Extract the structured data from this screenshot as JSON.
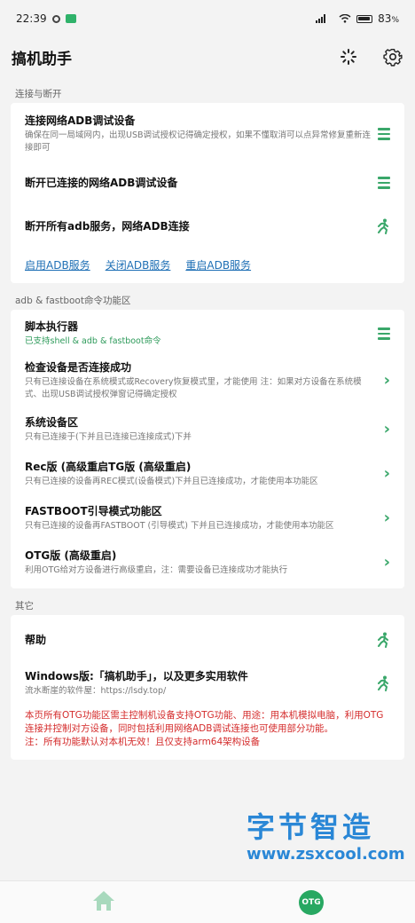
{
  "status_bar": {
    "time": "22:39",
    "battery": "83",
    "battery_suffix": "%",
    "battery_level": 0.83
  },
  "app": {
    "title": "搞机助手"
  },
  "icons": {
    "refresh": "loading-icon",
    "settings": "gear-icon",
    "home": "home-icon"
  },
  "sections": {
    "connect": {
      "label": "连接与断开",
      "rows": [
        {
          "title": "连接网络ADB调试设备",
          "desc": "确保在同一局域网内，出现USB调试授权记得确定授权，如果不懂取消可以点异常修复重新连接即可",
          "icon": "menu-icon"
        },
        {
          "title": "断开已连接的网络ADB调试设备",
          "icon": "menu-icon"
        },
        {
          "title": "断开所有adb服务，网络ADB连接",
          "icon": "running-person-icon"
        }
      ],
      "links": [
        "启用ADB服务",
        "关闭ADB服务",
        "重启ADB服务"
      ]
    },
    "fastboot": {
      "label": "adb & fastboot命令功能区",
      "rows": [
        {
          "title": "脚本执行器",
          "desc": "已支持shell & adb & fastboot命令",
          "icon": "menu-icon"
        },
        {
          "title": "检查设备是否连接成功",
          "desc": "只有已连接设备在系统模式或Recovery恢复模式里，才能使用 注：如果对方设备在系统模式、出现USB调试授权弹窗记得确定授权",
          "icon": "chevron-right-icon"
        },
        {
          "title": "系统设备区",
          "desc": "只有已连接于(下并且已连接已连接成式)下并",
          "icon": "chevron-right-icon"
        },
        {
          "title": "Rec版 (高级重启TG版 (高级重启)",
          "desc": "只有已连接的设备再REC模式(设备模式)下并且已连接成功，才能使用本功能区",
          "icon": "chevron-right-icon"
        },
        {
          "title": "FASTBOOT引导模式功能区",
          "desc": "只有已连接的设备再FASTBOOT (引导模式) 下并且已连接成功，才能使用本功能区",
          "icon": "chevron-right-icon"
        },
        {
          "title": "OTG版 (高级重启)",
          "desc": "利用OTG给对方设备进行高级重启，注：需要设备已连接成功才能执行",
          "icon": "chevron-right-icon"
        }
      ]
    },
    "other": {
      "label": "其它",
      "rows": [
        {
          "title": "帮助",
          "icon": "running-person-icon"
        },
        {
          "title": "Windows版:「搞机助手」，以及更多实用软件",
          "desc": "流水断崖的软件屋：https://lsdy.top/",
          "icon": "running-person-icon"
        }
      ],
      "note": "本页所有OTG功能区需主控制机设备支持OTG功能、用途：用本机模拟电脑，利用OTG连接并控制对方设备，同时包括利用网络ADB调试连接也可使用部分功能。\n注：所有功能默认对本机无效！且仅支持arm64架构设备"
    }
  },
  "bottom_nav": {
    "otg_label": "OTG"
  },
  "watermark": {
    "line1": "字节智造",
    "line2": "www.zsxcool.com"
  },
  "colors": {
    "accent": "#3aa76a",
    "link": "#1e6fb5",
    "warning": "#d42b2b"
  }
}
